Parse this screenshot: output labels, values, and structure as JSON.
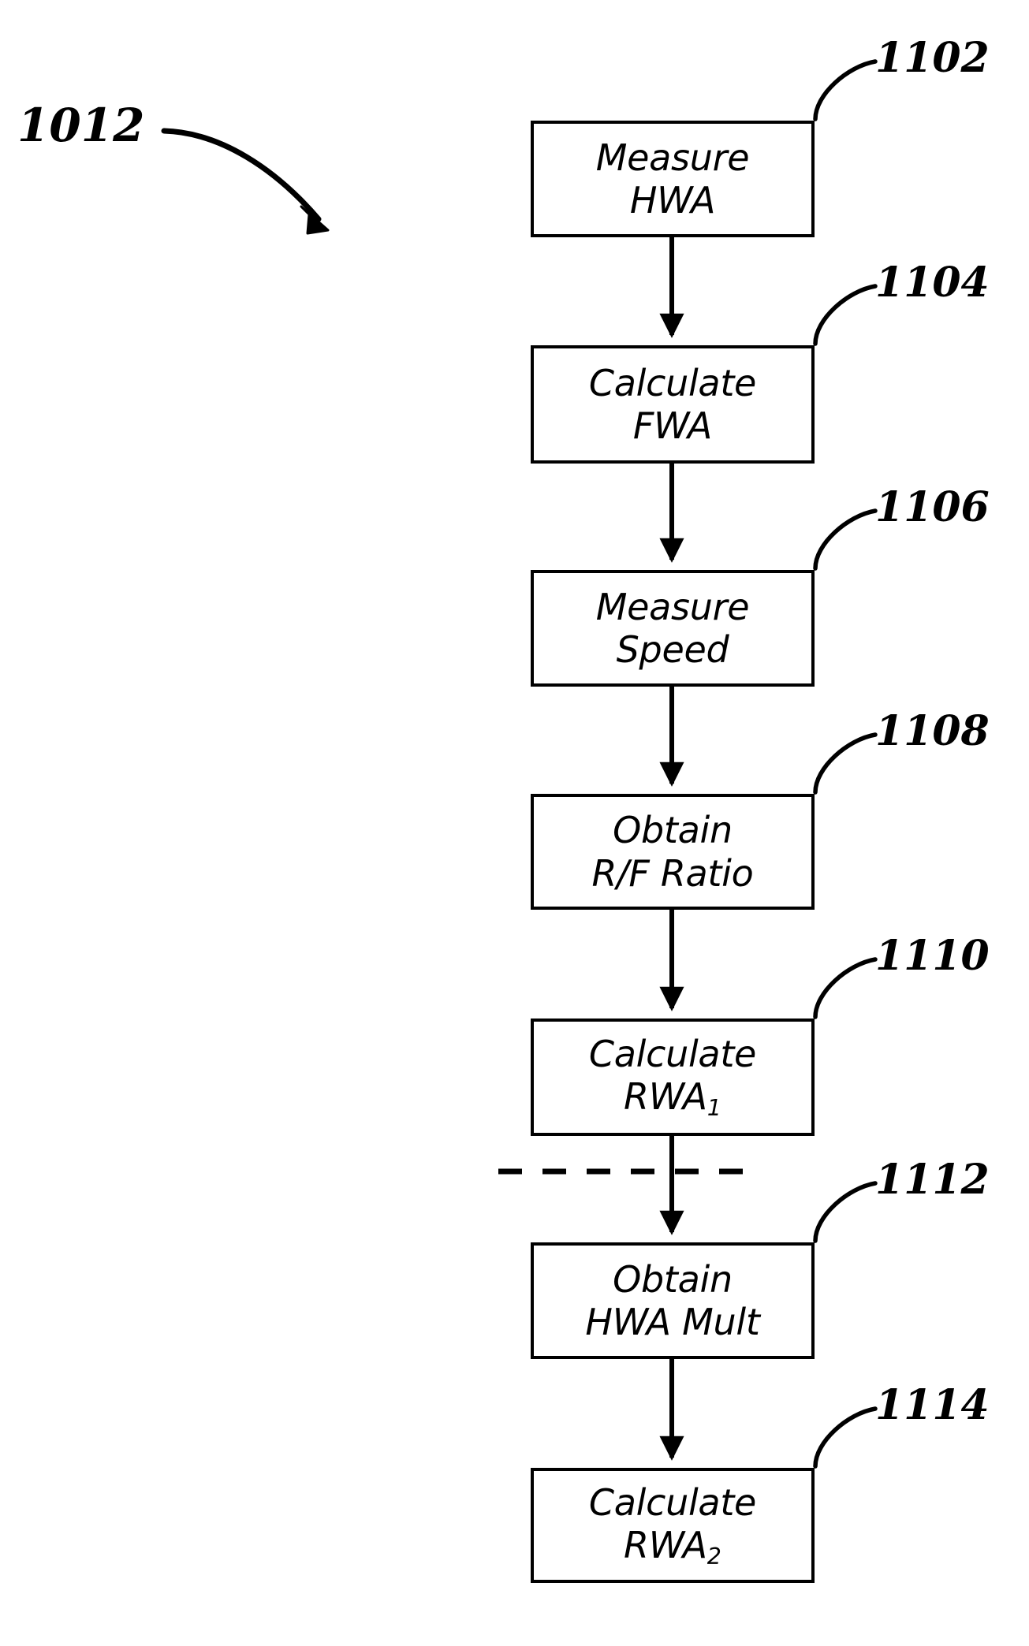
{
  "figure": {
    "main_reference": "1012",
    "background_color": "#ffffff",
    "line_color": "#000000"
  },
  "steps": [
    {
      "ref": "1102",
      "line1": "Measure",
      "line2": "HWA",
      "line2_sub": ""
    },
    {
      "ref": "1104",
      "line1": "Calculate",
      "line2": "FWA",
      "line2_sub": ""
    },
    {
      "ref": "1106",
      "line1": "Measure",
      "line2": "Speed",
      "line2_sub": ""
    },
    {
      "ref": "1108",
      "line1": "Obtain",
      "line2": "R/F Ratio",
      "line2_sub": ""
    },
    {
      "ref": "1110",
      "line1": "Calculate",
      "line2": "RWA",
      "line2_sub": "1"
    },
    {
      "ref": "1112",
      "line1": "Obtain",
      "line2": "HWA Mult",
      "line2_sub": ""
    },
    {
      "ref": "1114",
      "line1": "Calculate",
      "line2": "RWA",
      "line2_sub": "2"
    }
  ]
}
